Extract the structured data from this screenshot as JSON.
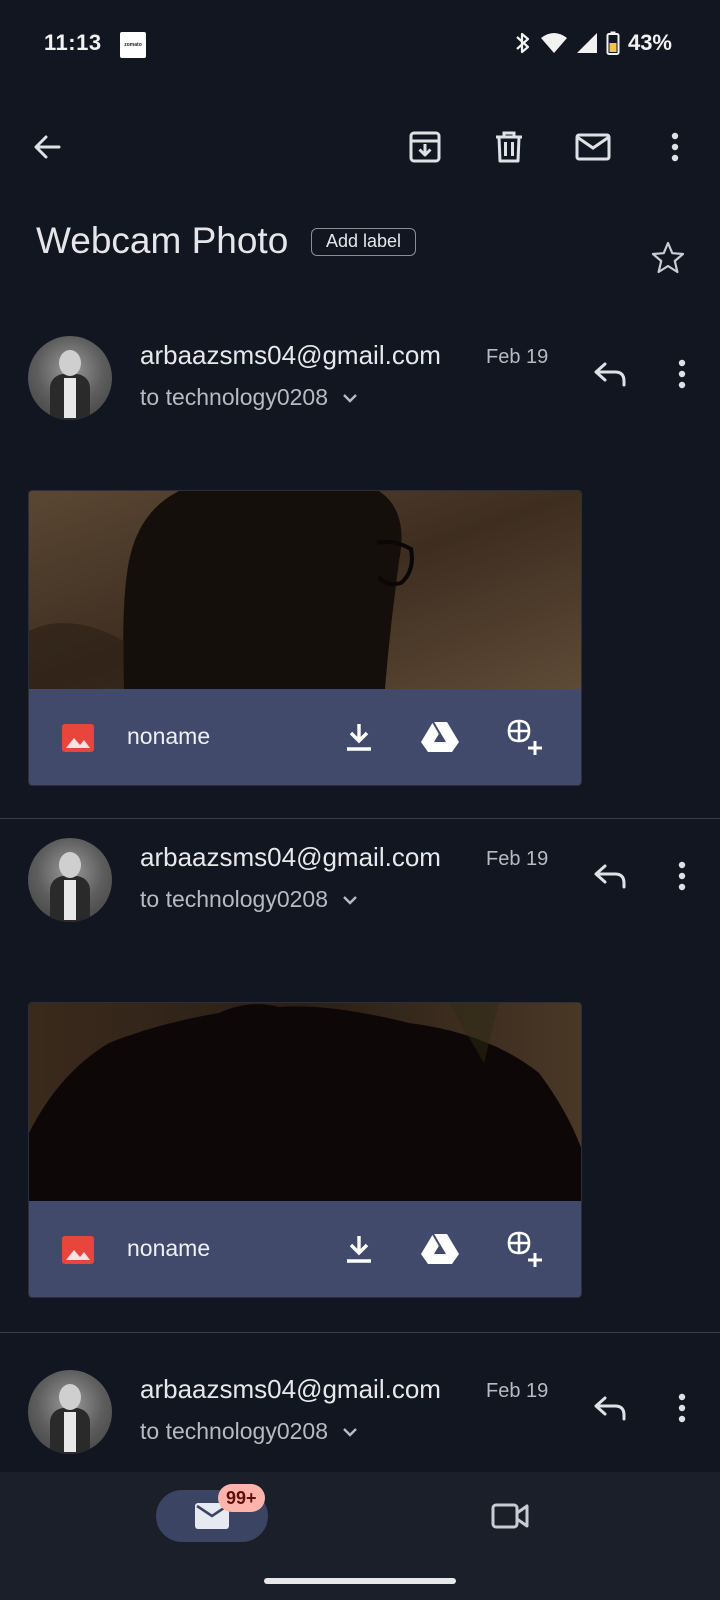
{
  "status_bar": {
    "time": "11:13",
    "notification_app": "zomato",
    "battery": "43%"
  },
  "toolbar": {
    "back_icon": "arrow-back-icon",
    "archive_icon": "archive-icon",
    "delete_icon": "trash-icon",
    "mark_unread_icon": "mail-icon",
    "more_icon": "more-vert-icon"
  },
  "thread": {
    "subject": "Webcam Photo",
    "add_label": "Add label"
  },
  "messages": [
    {
      "sender": "arbaazsms04@gmail.com",
      "date": "Feb 19",
      "recipient": "to technology0208",
      "attachment": {
        "name": "noname"
      }
    },
    {
      "sender": "arbaazsms04@gmail.com",
      "date": "Feb 19",
      "recipient": "to technology0208",
      "attachment": {
        "name": "noname"
      }
    },
    {
      "sender": "arbaazsms04@gmail.com",
      "date": "Feb 19",
      "recipient": "to technology0208"
    }
  ],
  "bottom_nav": {
    "mail_badge": "99+"
  },
  "colors": {
    "background": "#121620",
    "attachment_bar": "#424a6c",
    "nav_active": "#3b4563",
    "badge": "#ffb4ab",
    "image_icon": "#e8453c"
  }
}
